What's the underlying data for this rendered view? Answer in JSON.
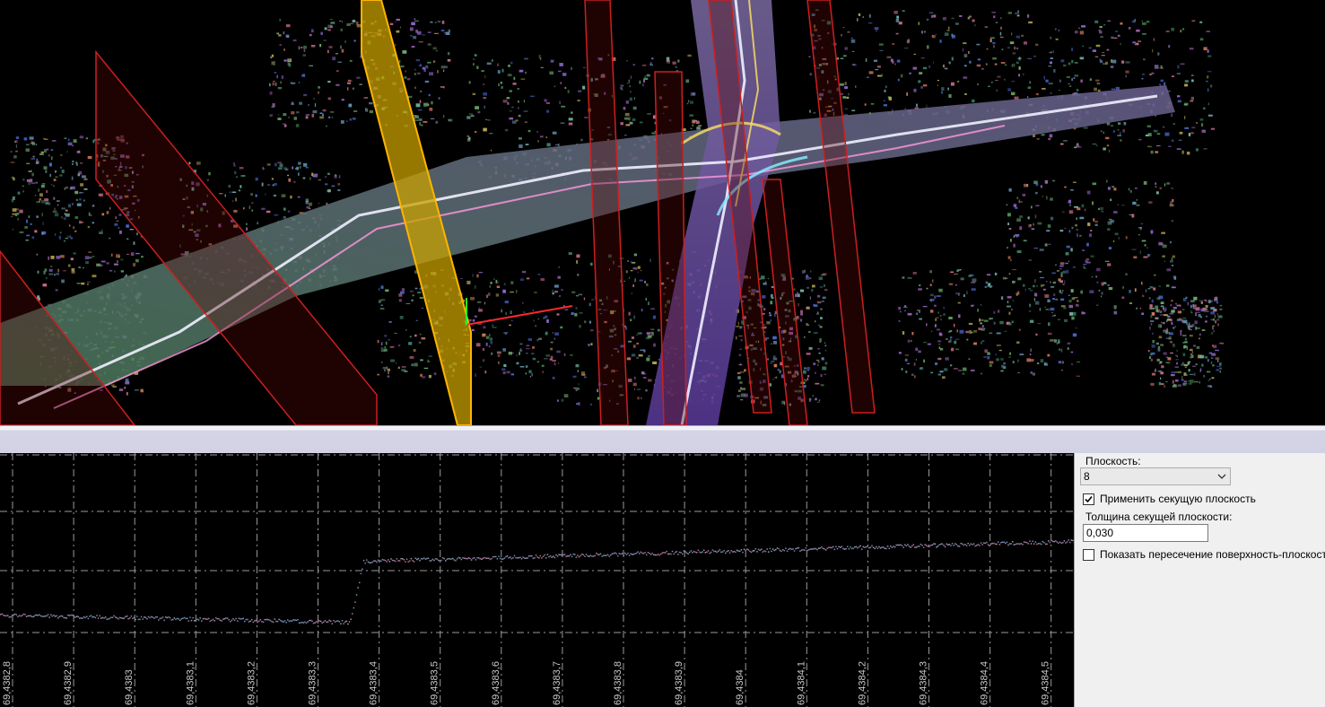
{
  "colors": {
    "viewport_bg": "#000000",
    "plane_red": "#cc1f1f",
    "plane_selected": "#e8c21a",
    "axis_x": "#ff2a2a",
    "axis_y": "#22ff22",
    "grid": "#9a9a9a",
    "panel_bg": "#f0f0f0"
  },
  "properties": {
    "plane_label": "Плоскость:",
    "plane_value": "8",
    "apply_cutting_plane_label": "Применить секущую плоскость",
    "apply_cutting_plane_checked": true,
    "thickness_label": "Толщина секущей плоскости:",
    "thickness_value": "0,030",
    "show_intersection_label": "Показать пересечение поверхность-плоскость",
    "show_intersection_checked": false
  },
  "section_view": {
    "x_ticks": [
      "69,4382,8",
      "69,4382,9",
      "69,4383",
      "69,4383,1",
      "69,4383,2",
      "69,4383,3",
      "69,4383,4",
      "69,4383,5",
      "69,4383,6",
      "69,4383,7",
      "69,4383,8",
      "69,4383,9",
      "69,4384",
      "69,4384,1",
      "69,4384,2",
      "69,4384,3",
      "69,4384,4",
      "69,4384,5"
    ]
  },
  "icons": {
    "combo_arrow": "chevron-down-icon",
    "checkbox_mark": "check-icon",
    "axis_gizmo": "axis-gizmo-icon"
  }
}
